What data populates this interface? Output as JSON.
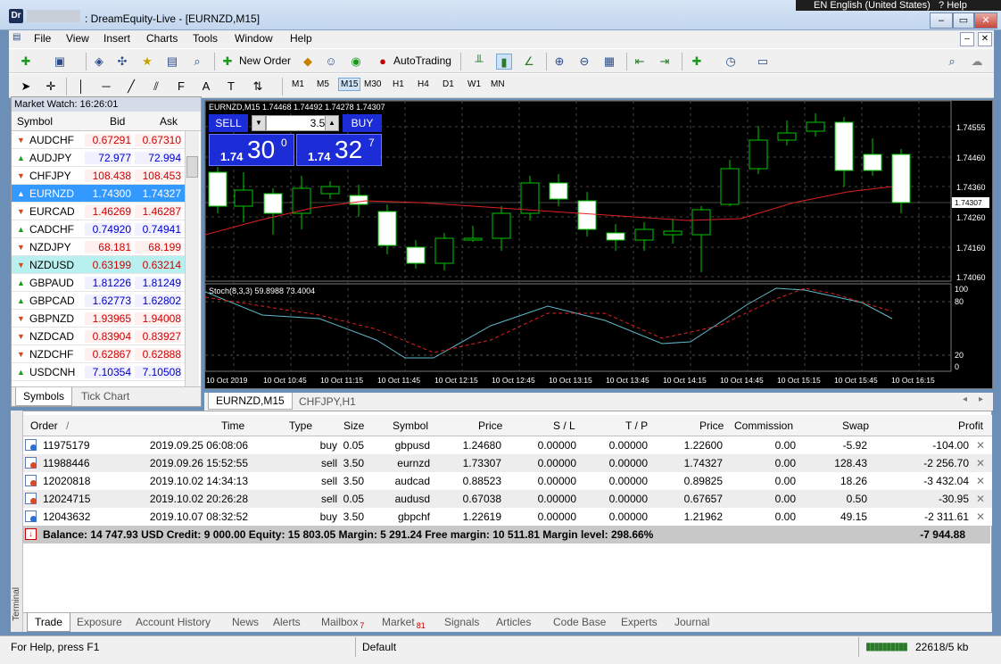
{
  "window": {
    "icon_text": "Dr",
    "title": ": DreamEquity-Live - [EURNZD,M15]",
    "language": "EN English (United States)",
    "help": "Help",
    "min": "–",
    "max": "▭",
    "close": "✕"
  },
  "menu": [
    "File",
    "View",
    "Insert",
    "Charts",
    "Tools",
    "Window",
    "Help"
  ],
  "toolbar": {
    "new_order": "New Order",
    "autotrading": "AutoTrading",
    "timeframes": [
      "M1",
      "M5",
      "M15",
      "M30",
      "H1",
      "H4",
      "D1",
      "W1",
      "MN"
    ],
    "active_timeframe": "M15"
  },
  "market_watch": {
    "title": "Market Watch: 16:26:01",
    "col_symbol": "Symbol",
    "col_bid": "Bid",
    "col_ask": "Ask",
    "rows": [
      {
        "symbol": "AUDCHF",
        "bid": "0.67291",
        "ask": "0.67310",
        "dir": "down"
      },
      {
        "symbol": "AUDJPY",
        "bid": "72.977",
        "ask": "72.994",
        "dir": "up"
      },
      {
        "symbol": "CHFJPY",
        "bid": "108.438",
        "ask": "108.453",
        "dir": "down"
      },
      {
        "symbol": "EURNZD",
        "bid": "1.74300",
        "ask": "1.74327",
        "dir": "up"
      },
      {
        "symbol": "EURCAD",
        "bid": "1.46269",
        "ask": "1.46287",
        "dir": "down"
      },
      {
        "symbol": "CADCHF",
        "bid": "0.74920",
        "ask": "0.74941",
        "dir": "up"
      },
      {
        "symbol": "NZDJPY",
        "bid": "68.181",
        "ask": "68.199",
        "dir": "down"
      },
      {
        "symbol": "NZDUSD",
        "bid": "0.63199",
        "ask": "0.63214",
        "dir": "down"
      },
      {
        "symbol": "GBPAUD",
        "bid": "1.81226",
        "ask": "1.81249",
        "dir": "up"
      },
      {
        "symbol": "GBPCAD",
        "bid": "1.62773",
        "ask": "1.62802",
        "dir": "up"
      },
      {
        "symbol": "GBPNZD",
        "bid": "1.93965",
        "ask": "1.94008",
        "dir": "down"
      },
      {
        "symbol": "NZDCAD",
        "bid": "0.83904",
        "ask": "0.83927",
        "dir": "down"
      },
      {
        "symbol": "NZDCHF",
        "bid": "0.62867",
        "ask": "0.62888",
        "dir": "down"
      },
      {
        "symbol": "USDCNH",
        "bid": "7.10354",
        "ask": "7.10508",
        "dir": "up"
      }
    ],
    "tab_symbols": "Symbols",
    "tab_tick": "Tick Chart"
  },
  "chart": {
    "header": "EURNZD,M15  1.74468 1.74492 1.74278 1.74307",
    "sell_label": "SELL",
    "buy_label": "BUY",
    "lot": "3.50",
    "sell_small": "1.74",
    "sell_big": "30",
    "sell_sup": "0",
    "buy_small": "1.74",
    "buy_big": "32",
    "buy_sup": "7",
    "price_labels": [
      "1.74555",
      "1.74460",
      "1.74360",
      "1.74260",
      "1.74160",
      "1.74060"
    ],
    "current_price": "1.74307",
    "stoch_label": "Stoch(8,3,3) 59.8988 73.4004",
    "stoch_levels": [
      "100",
      "80",
      "20",
      "0"
    ],
    "time_labels": [
      "10 Oct 2019",
      "10 Oct 10:45",
      "10 Oct 11:15",
      "10 Oct 11:45",
      "10 Oct 12:15",
      "10 Oct 12:45",
      "10 Oct 13:15",
      "10 Oct 13:45",
      "10 Oct 14:15",
      "10 Oct 14:45",
      "10 Oct 15:15",
      "10 Oct 15:45",
      "10 Oct 16:15"
    ],
    "tab_active": "EURNZD,M15",
    "tab_other": "CHFJPY,H1"
  },
  "terminal": {
    "side_label": "Terminal",
    "columns": [
      "Order",
      "/",
      "Time",
      "Type",
      "Size",
      "Symbol",
      "Price",
      "S / L",
      "T / P",
      "Price",
      "Commission",
      "Swap",
      "Profit"
    ],
    "rows": [
      {
        "order": "11975179",
        "time": "2019.09.25 06:08:06",
        "type": "buy",
        "size": "0.05",
        "symbol": "gbpusd",
        "price": "1.24680",
        "sl": "0.00000",
        "tp": "0.00000",
        "cur": "1.22600",
        "comm": "0.00",
        "swap": "-5.92",
        "profit": "-104.00"
      },
      {
        "order": "11988446",
        "time": "2019.09.26 15:52:55",
        "type": "sell",
        "size": "3.50",
        "symbol": "eurnzd",
        "price": "1.73307",
        "sl": "0.00000",
        "tp": "0.00000",
        "cur": "1.74327",
        "comm": "0.00",
        "swap": "128.43",
        "profit": "-2 256.70"
      },
      {
        "order": "12020818",
        "time": "2019.10.02 14:34:13",
        "type": "sell",
        "size": "3.50",
        "symbol": "audcad",
        "price": "0.88523",
        "sl": "0.00000",
        "tp": "0.00000",
        "cur": "0.89825",
        "comm": "0.00",
        "swap": "18.26",
        "profit": "-3 432.04"
      },
      {
        "order": "12024715",
        "time": "2019.10.02 20:26:28",
        "type": "sell",
        "size": "0.05",
        "symbol": "audusd",
        "price": "0.67038",
        "sl": "0.00000",
        "tp": "0.00000",
        "cur": "0.67657",
        "comm": "0.00",
        "swap": "0.50",
        "profit": "-30.95"
      },
      {
        "order": "12043632",
        "time": "2019.10.07 08:32:52",
        "type": "buy",
        "size": "3.50",
        "symbol": "gbpchf",
        "price": "1.22619",
        "sl": "0.00000",
        "tp": "0.00000",
        "cur": "1.21962",
        "comm": "0.00",
        "swap": "49.15",
        "profit": "-2 311.61"
      }
    ],
    "balance_line": "Balance: 14 747.93 USD  Credit: 9 000.00  Equity: 15 803.05  Margin: 5 291.24  Free margin: 10 511.81  Margin level: 298.66%",
    "total_profit": "-7 944.88",
    "tabs": [
      {
        "label": "Trade",
        "badge": ""
      },
      {
        "label": "Exposure",
        "badge": ""
      },
      {
        "label": "Account History",
        "badge": ""
      },
      {
        "label": "News",
        "badge": ""
      },
      {
        "label": "Alerts",
        "badge": ""
      },
      {
        "label": "Mailbox",
        "badge": "7"
      },
      {
        "label": "Market",
        "badge": "81"
      },
      {
        "label": "Signals",
        "badge": ""
      },
      {
        "label": "Articles",
        "badge": ""
      },
      {
        "label": "Code Base",
        "badge": ""
      },
      {
        "label": "Experts",
        "badge": ""
      },
      {
        "label": "Journal",
        "badge": ""
      }
    ]
  },
  "status": {
    "help": "For Help, press F1",
    "profile": "Default",
    "traffic": "22618/5 kb"
  },
  "colors": {
    "bid_down": "#d00000",
    "bid_up": "#0000c8",
    "bull": "#00c800",
    "trade_blue": "#1c2dd8"
  }
}
